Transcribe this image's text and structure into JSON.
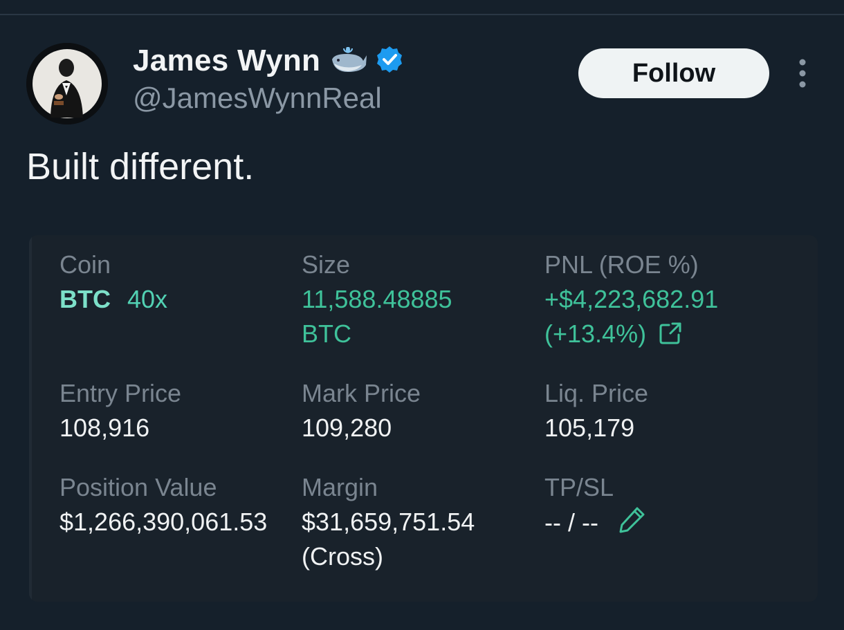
{
  "tweet": {
    "author": {
      "display_name": "James Wynn",
      "handle": "@JamesWynnReal",
      "badges": [
        "whale-emoji",
        "verified-badge"
      ],
      "verified_color": "#1d9bf0"
    },
    "follow_label": "Follow",
    "text": "Built different."
  },
  "position": {
    "coin": {
      "label": "Coin",
      "symbol": "BTC",
      "leverage": "40x"
    },
    "size": {
      "label": "Size",
      "value": "11,588.48885",
      "unit": "BTC"
    },
    "pnl": {
      "label": "PNL (ROE %)",
      "value": "+$4,223,682.91",
      "roe": "(+13.4%)",
      "icon": "external-link-icon"
    },
    "entry_price": {
      "label": "Entry Price",
      "value": "108,916"
    },
    "mark_price": {
      "label": "Mark Price",
      "value": "109,280"
    },
    "liq_price": {
      "label": "Liq. Price",
      "value": "105,179"
    },
    "position_value": {
      "label": "Position Value",
      "value": "$1,266,390,061.53"
    },
    "margin": {
      "label": "Margin",
      "value": "$31,659,751.54",
      "mode": "(Cross)"
    },
    "tpsl": {
      "label": "TP/SL",
      "value": "-- / --",
      "icon": "pencil-icon"
    }
  },
  "colors": {
    "background": "#15202b",
    "card": "#19222b",
    "profit_green": "#3fc29a",
    "coin_accent": "#7de0c9",
    "muted_text": "#7a8590"
  }
}
